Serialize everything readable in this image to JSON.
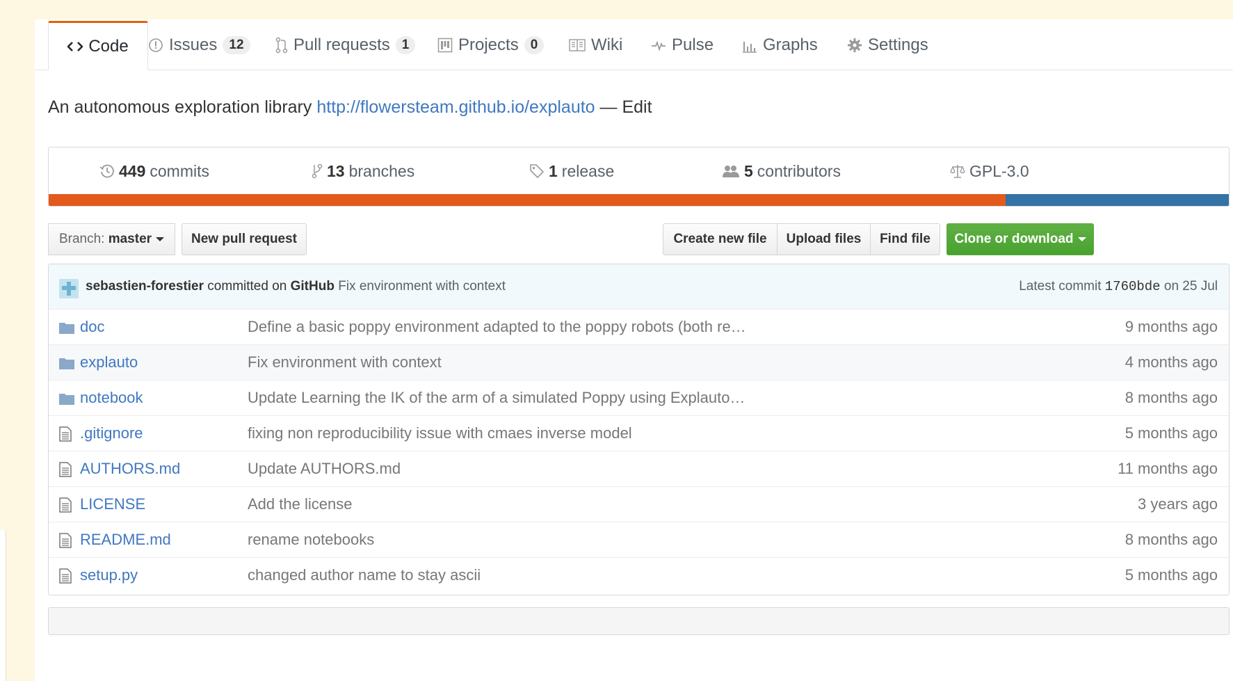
{
  "tabs": [
    {
      "label": "Code",
      "icon": "code-icon",
      "counter": null,
      "selected": true
    },
    {
      "label": "Issues",
      "icon": "issue-icon",
      "counter": "12"
    },
    {
      "label": "Pull requests",
      "icon": "pull-request-icon",
      "counter": "1"
    },
    {
      "label": "Projects",
      "icon": "project-icon",
      "counter": "0"
    },
    {
      "label": "Wiki",
      "icon": "book-icon",
      "counter": null
    },
    {
      "label": "Pulse",
      "icon": "pulse-icon",
      "counter": null
    },
    {
      "label": "Graphs",
      "icon": "graph-icon",
      "counter": null
    },
    {
      "label": "Settings",
      "icon": "gear-icon",
      "counter": null
    }
  ],
  "description": {
    "text": "An autonomous exploration library",
    "url": "http://flowersteam.github.io/explauto",
    "edit": "— Edit"
  },
  "summary": {
    "commits": {
      "count": "449",
      "label": "commits"
    },
    "branches": {
      "count": "13",
      "label": "branches"
    },
    "releases": {
      "count": "1",
      "label": "release"
    },
    "contributors": {
      "count": "5",
      "label": "contributors"
    },
    "license": "GPL-3.0"
  },
  "languages": [
    {
      "color": "#e25a1c",
      "percent": 81.1
    },
    {
      "color": "#3572a5",
      "percent": 18.9
    }
  ],
  "file_nav": {
    "branch_prefix": "Branch:",
    "branch_name": "master",
    "new_pull_request": "New pull request",
    "create_new_file": "Create new file",
    "upload_files": "Upload files",
    "find_file": "Find file",
    "clone_or_download": "Clone or download"
  },
  "latest_commit": {
    "author": "sebastien-forestier",
    "committed_on": "committed on",
    "platform": "GitHub",
    "message": "Fix environment with context",
    "prefix": "Latest commit",
    "sha": "1760bde",
    "date": "on 25 Jul"
  },
  "files": [
    {
      "type": "folder",
      "name": "doc",
      "message": "Define a basic poppy environment adapted to the poppy robots (both re…",
      "age": "9 months ago"
    },
    {
      "type": "folder",
      "name": "explauto",
      "message": "Fix environment with context",
      "age": "4 months ago"
    },
    {
      "type": "folder",
      "name": "notebook",
      "message": "Update Learning the IK of the arm of a simulated Poppy using Explauto…",
      "age": "8 months ago"
    },
    {
      "type": "file",
      "name": ".gitignore",
      "message": "fixing non reproducibility issue with cmaes inverse model",
      "age": "5 months ago"
    },
    {
      "type": "file",
      "name": "AUTHORS.md",
      "message": "Update AUTHORS.md",
      "age": "11 months ago"
    },
    {
      "type": "file",
      "name": "LICENSE",
      "message": "Add the license",
      "age": "3 years ago"
    },
    {
      "type": "file",
      "name": "README.md",
      "message": "rename notebooks",
      "age": "8 months ago"
    },
    {
      "type": "file",
      "name": "setup.py",
      "message": "changed author name to stay ascii",
      "age": "5 months ago"
    }
  ],
  "colors": {
    "link": "#4078c0",
    "tab_accent": "#e36209",
    "green_button": "#55a532"
  }
}
